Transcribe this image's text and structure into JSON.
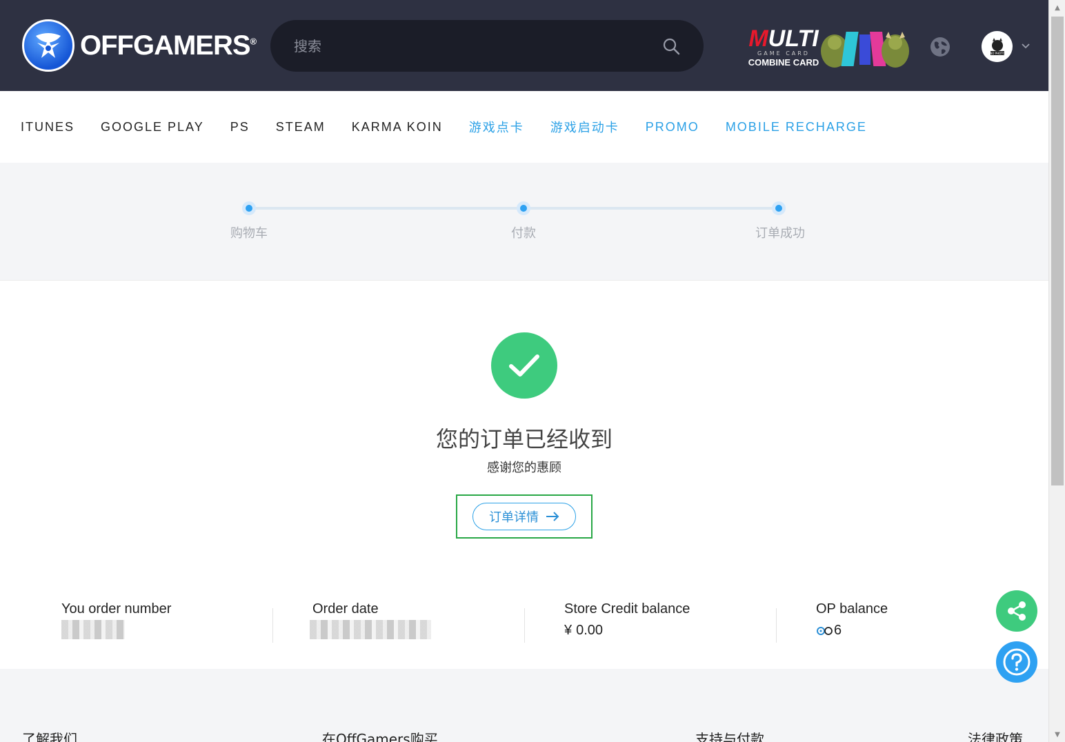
{
  "header": {
    "brand": "OFFGAMERS",
    "brand_mark": "®",
    "search_placeholder": "搜索",
    "promo": {
      "line1_red": "M",
      "line1_rest": "ULTI",
      "line2": "GAME CARD",
      "line3": "COMBINE CARD"
    },
    "avatar_text": "NO PHOTO"
  },
  "nav": {
    "items": [
      {
        "label": "ITUNES",
        "highlight": false
      },
      {
        "label": "GOOGLE PLAY",
        "highlight": false
      },
      {
        "label": "PS",
        "highlight": false
      },
      {
        "label": "STEAM",
        "highlight": false
      },
      {
        "label": "KARMA KOIN",
        "highlight": false
      },
      {
        "label": "游戏点卡",
        "highlight": true
      },
      {
        "label": "游戏启动卡",
        "highlight": true
      },
      {
        "label": "PROMO",
        "highlight": true
      },
      {
        "label": "MOBILE RECHARGE",
        "highlight": true
      }
    ]
  },
  "steps": {
    "items": [
      {
        "label": "购物车"
      },
      {
        "label": "付款"
      },
      {
        "label": "订单成功"
      }
    ]
  },
  "main": {
    "title": "您的订单已经收到",
    "subtitle": "感谢您的惠顾",
    "detail_button": "订单详情",
    "info": {
      "order_number_label": "You order number",
      "order_date_label": "Order date",
      "store_credit_label": "Store Credit balance",
      "store_credit_currency": "¥",
      "store_credit_value": "0.00",
      "op_label": "OP balance",
      "op_value": "6"
    }
  },
  "footer": {
    "links": [
      "了解我们",
      "在OffGamers购买",
      "支持与付款",
      "法律政策"
    ]
  },
  "colors": {
    "header_bg": "#2e3142",
    "accent_blue": "#2aa0e6",
    "success_green": "#3ecb7e",
    "highlight_frame": "#28a745"
  }
}
